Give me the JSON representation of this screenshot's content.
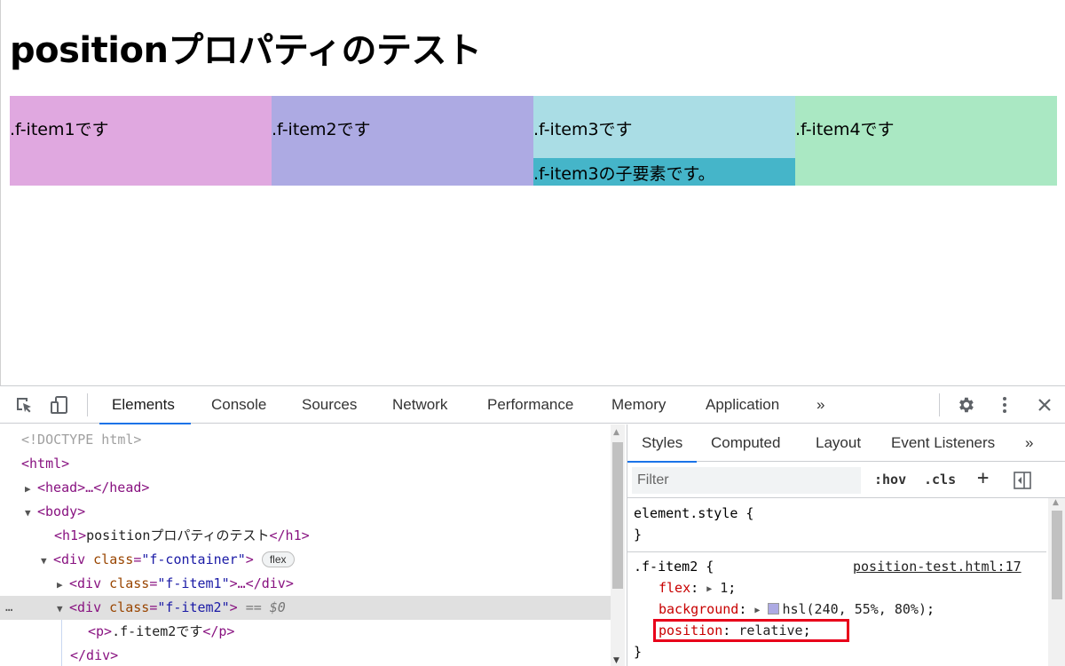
{
  "page": {
    "title": "positionプロパティのテスト",
    "items": [
      {
        "label": ".f-item1です",
        "color": "#e0a8e0"
      },
      {
        "label": ".f-item2です",
        "color": "#adaae3"
      },
      {
        "label": ".f-item3です",
        "color": "#aadde5"
      },
      {
        "label": ".f-item4です",
        "color": "#aae8c3"
      }
    ],
    "child": {
      "label": ".f-item3の子要素です。",
      "color": "#45b5c9"
    }
  },
  "devtools": {
    "toolbar": {
      "tabs": [
        "Elements",
        "Console",
        "Sources",
        "Network",
        "Performance",
        "Memory",
        "Application"
      ],
      "active_tab": "Elements",
      "more": "»",
      "icons": [
        "inspect-icon",
        "device-toggle-icon",
        "gear-icon",
        "kebab-menu-icon",
        "close-icon"
      ]
    },
    "elements": {
      "lines": {
        "doctype": "<!DOCTYPE html>",
        "html_open": "<html>",
        "head": "<head>…</head>",
        "body_open": "<body>",
        "h1_open": "<h1>",
        "h1_text": "positionプロパティのテスト",
        "h1_close": "</h1>",
        "div_open": "<div ",
        "class_attr": "class",
        "container_class": "\"f-container\"",
        "flex_badge": "flex",
        "item1_class": "\"f-item1\"",
        "item1_tail": ">…</div>",
        "item2_class": "\"f-item2\"",
        "gt": ">",
        "selected_marker": "== $0",
        "p_open": "<p>",
        "p_text": ".f-item2です",
        "p_close": "</p>",
        "div_close": "</div>",
        "ellipsis": "…"
      }
    },
    "styles": {
      "tabs": [
        "Styles",
        "Computed",
        "Layout",
        "Event Listeners"
      ],
      "active_tab": "Styles",
      "more": "»",
      "filter_placeholder": "Filter",
      "hov": ":hov",
      "cls": ".cls",
      "plus": "+",
      "element_style_selector": "element.style {",
      "close_brace": "}",
      "rule_selector": ".f-item2 {",
      "rule_source": "position-test.html:17",
      "flex_prop": "flex",
      "flex_value": "1",
      "bg_prop": "background",
      "bg_value": "hsl(240, 55%, 80%)",
      "bg_swatch": "#adaae3",
      "pos_prop": "position",
      "pos_value": "relative",
      "colon": ":",
      "semicolon": ";"
    }
  }
}
